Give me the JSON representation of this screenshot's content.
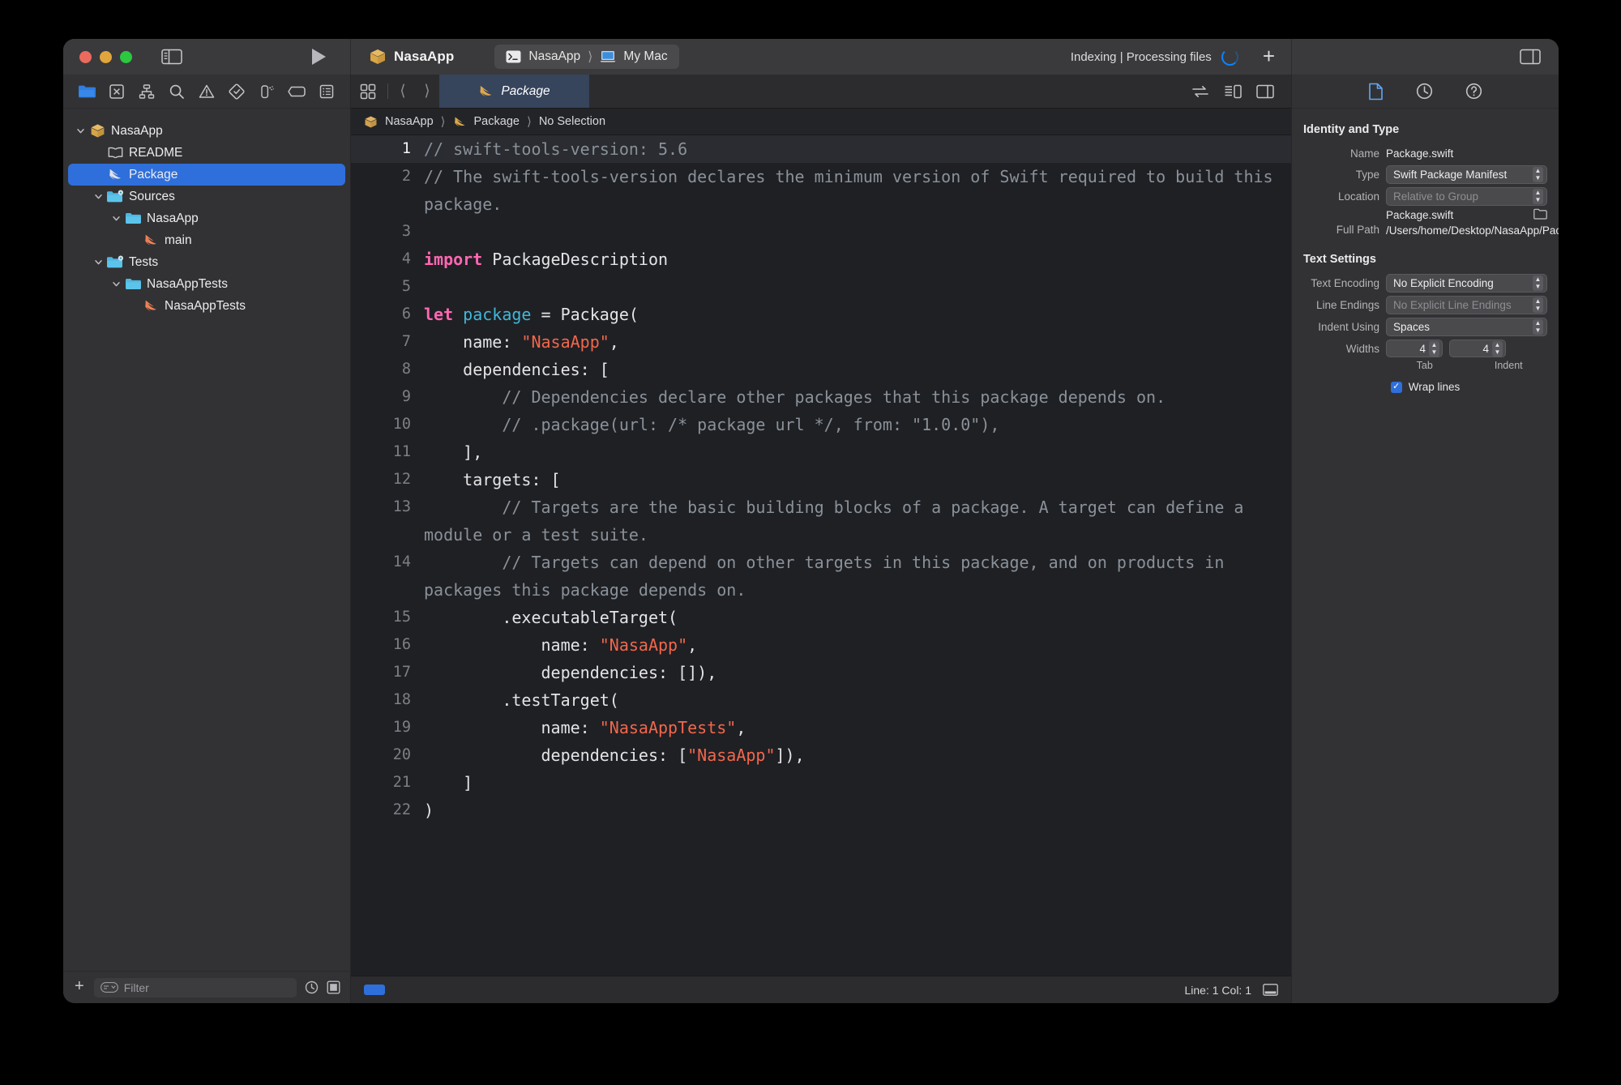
{
  "window": {
    "traffic": {
      "close": "close-button",
      "minimize": "minimize-button",
      "zoom": "zoom-button"
    },
    "project_name": "NasaApp",
    "scheme": "NasaApp",
    "destination": "My Mac",
    "status": "Indexing | Processing files",
    "add_label": "+"
  },
  "navigator": {
    "toolbar_icons": [
      "folder-icon",
      "source-control-icon",
      "hierarchy-icon",
      "search-icon",
      "warning-icon",
      "test-icon",
      "debug-icon",
      "breakpoint-icon",
      "report-icon"
    ],
    "tree": [
      {
        "label": "NasaApp",
        "icon": "package-icon",
        "depth": 0,
        "twisty": "v",
        "selected": false
      },
      {
        "label": "README",
        "icon": "readme-icon",
        "depth": 1,
        "twisty": "",
        "selected": false
      },
      {
        "label": "Package",
        "icon": "swift-icon",
        "depth": 1,
        "twisty": "",
        "selected": true
      },
      {
        "label": "Sources",
        "icon": "folder-gear-icon",
        "depth": 1,
        "twisty": "v",
        "selected": false
      },
      {
        "label": "NasaApp",
        "icon": "folder-icon",
        "depth": 2,
        "twisty": "v",
        "selected": false
      },
      {
        "label": "main",
        "icon": "swift-orange-icon",
        "depth": 3,
        "twisty": "",
        "selected": false
      },
      {
        "label": "Tests",
        "icon": "folder-gear-icon",
        "depth": 1,
        "twisty": "v",
        "selected": false
      },
      {
        "label": "NasaAppTests",
        "icon": "folder-icon",
        "depth": 2,
        "twisty": "v",
        "selected": false
      },
      {
        "label": "NasaAppTests",
        "icon": "swift-orange-icon",
        "depth": 3,
        "twisty": "",
        "selected": false
      }
    ],
    "filter_placeholder": "Filter",
    "add_label": "+"
  },
  "editor": {
    "tab_label": "Package",
    "breadcrumb": [
      "NasaApp",
      "Package",
      "No Selection"
    ],
    "lines": [
      {
        "n": "1",
        "cur": true,
        "tokens": [
          {
            "t": "cm",
            "s": "// swift-tools-version: 5.6"
          }
        ]
      },
      {
        "n": "2",
        "cur": false,
        "tokens": [
          {
            "t": "cm",
            "s": "// The swift-tools-version declares the minimum version of Swift required to build this package."
          }
        ]
      },
      {
        "n": "3",
        "cur": false,
        "tokens": [
          {
            "t": "pl",
            "s": ""
          }
        ]
      },
      {
        "n": "4",
        "cur": false,
        "tokens": [
          {
            "t": "kw",
            "s": "import"
          },
          {
            "t": "pl",
            "s": " PackageDescription"
          }
        ]
      },
      {
        "n": "5",
        "cur": false,
        "tokens": [
          {
            "t": "pl",
            "s": ""
          }
        ]
      },
      {
        "n": "6",
        "cur": false,
        "tokens": [
          {
            "t": "kw",
            "s": "let"
          },
          {
            "t": "pl",
            "s": " "
          },
          {
            "t": "id",
            "s": "package"
          },
          {
            "t": "pl",
            "s": " = Package("
          }
        ]
      },
      {
        "n": "7",
        "cur": false,
        "tokens": [
          {
            "t": "pl",
            "s": "    name: "
          },
          {
            "t": "str",
            "s": "\"NasaApp\""
          },
          {
            "t": "pl",
            "s": ","
          }
        ]
      },
      {
        "n": "8",
        "cur": false,
        "tokens": [
          {
            "t": "pl",
            "s": "    dependencies: ["
          }
        ]
      },
      {
        "n": "9",
        "cur": false,
        "tokens": [
          {
            "t": "cm",
            "s": "        // Dependencies declare other packages that this package depends on."
          }
        ]
      },
      {
        "n": "10",
        "cur": false,
        "tokens": [
          {
            "t": "cm",
            "s": "        // .package(url: /* package url */, from: \"1.0.0\"),"
          }
        ]
      },
      {
        "n": "11",
        "cur": false,
        "tokens": [
          {
            "t": "pl",
            "s": "    ],"
          }
        ]
      },
      {
        "n": "12",
        "cur": false,
        "tokens": [
          {
            "t": "pl",
            "s": "    targets: ["
          }
        ]
      },
      {
        "n": "13",
        "cur": false,
        "tokens": [
          {
            "t": "cm",
            "s": "        // Targets are the basic building blocks of a package. A target can define a module or a test suite."
          }
        ]
      },
      {
        "n": "14",
        "cur": false,
        "tokens": [
          {
            "t": "cm",
            "s": "        // Targets can depend on other targets in this package, and on products in packages this package depends on."
          }
        ]
      },
      {
        "n": "15",
        "cur": false,
        "tokens": [
          {
            "t": "pl",
            "s": "        .executableTarget("
          }
        ]
      },
      {
        "n": "16",
        "cur": false,
        "tokens": [
          {
            "t": "pl",
            "s": "            name: "
          },
          {
            "t": "str",
            "s": "\"NasaApp\""
          },
          {
            "t": "pl",
            "s": ","
          }
        ]
      },
      {
        "n": "17",
        "cur": false,
        "tokens": [
          {
            "t": "pl",
            "s": "            dependencies: []),"
          }
        ]
      },
      {
        "n": "18",
        "cur": false,
        "tokens": [
          {
            "t": "pl",
            "s": "        .testTarget("
          }
        ]
      },
      {
        "n": "19",
        "cur": false,
        "tokens": [
          {
            "t": "pl",
            "s": "            name: "
          },
          {
            "t": "str",
            "s": "\"NasaAppTests\""
          },
          {
            "t": "pl",
            "s": ","
          }
        ]
      },
      {
        "n": "20",
        "cur": false,
        "tokens": [
          {
            "t": "pl",
            "s": "            dependencies: ["
          },
          {
            "t": "str",
            "s": "\"NasaApp\""
          },
          {
            "t": "pl",
            "s": "]),"
          }
        ]
      },
      {
        "n": "21",
        "cur": false,
        "tokens": [
          {
            "t": "pl",
            "s": "    ]"
          }
        ]
      },
      {
        "n": "22",
        "cur": false,
        "tokens": [
          {
            "t": "pl",
            "s": ")"
          }
        ]
      }
    ],
    "status_line": "Line: 1  Col: 1"
  },
  "inspector": {
    "tabs": [
      "file-inspector-icon",
      "history-inspector-icon",
      "quick-help-icon"
    ],
    "identity_section": {
      "title": "Identity and Type",
      "name_label": "Name",
      "name_value": "Package.swift",
      "type_label": "Type",
      "type_value": "Swift Package Manifest",
      "location_label": "Location",
      "location_value": "Relative to Group",
      "location_file": "Package.swift",
      "fullpath_label": "Full Path",
      "fullpath_value": "/Users/home/Desktop/NasaApp/Package.swift"
    },
    "text_section": {
      "title": "Text Settings",
      "encoding_label": "Text Encoding",
      "encoding_value": "No Explicit Encoding",
      "line_endings_label": "Line Endings",
      "line_endings_value": "No Explicit Line Endings",
      "indent_label": "Indent Using",
      "indent_value": "Spaces",
      "widths_label": "Widths",
      "tab_value": "4",
      "indent_value_num": "4",
      "tab_sublabel": "Tab",
      "indent_sublabel": "Indent",
      "wrap_label": "Wrap lines",
      "wrap_checked": true
    }
  },
  "colors": {
    "accent": "#2f6fdb",
    "keyword": "#ff67b2",
    "identifier": "#41b7d8",
    "string": "#f2674c",
    "comment": "#8a9199",
    "editor_bg": "#1f2024",
    "chrome_bg": "#323234"
  }
}
